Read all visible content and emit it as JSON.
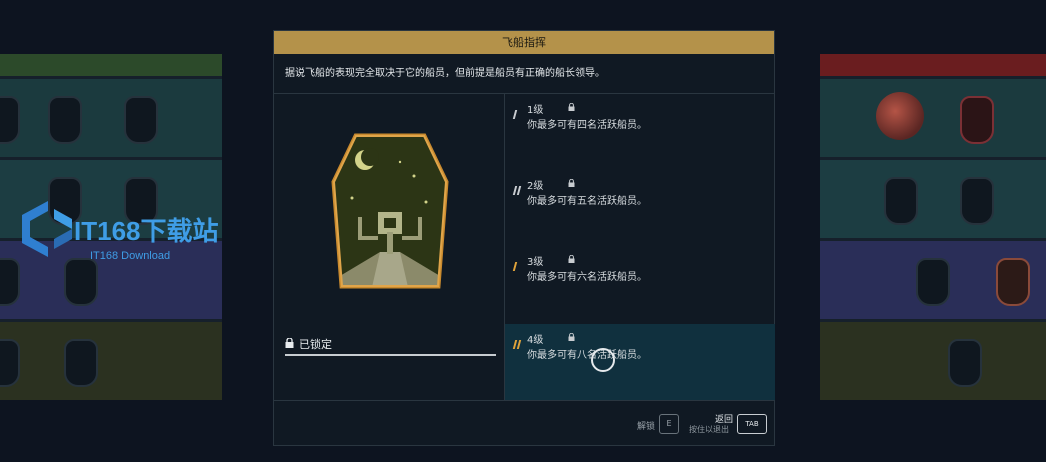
{
  "dialog": {
    "title": "飞船指挥",
    "description": "据说飞船的表现完全取决于它的船员，但前提是船员有正确的船长领导。",
    "lock_status": "已锁定",
    "tiers": [
      {
        "level": "1级",
        "desc": "你最多可有四名活跃船员。",
        "mark_count": 1,
        "mark_color": "#c8ccd0"
      },
      {
        "level": "2级",
        "desc": "你最多可有五名活跃船员。",
        "mark_count": 2,
        "mark_color": "#c8ccd0"
      },
      {
        "level": "3级",
        "desc": "你最多可有六名活跃船员。",
        "mark_count": 1,
        "mark_color": "#e0a33a"
      },
      {
        "level": "4级",
        "desc": "你最多可有八名活跃船员。",
        "mark_count": 2,
        "mark_color": "#e0a33a"
      }
    ],
    "active_tier": 4
  },
  "footer": {
    "unlock_label": "解锁",
    "unlock_key": "E",
    "back_label": "返回",
    "back_hint": "按住以退出",
    "back_key": "TAB"
  },
  "watermark": {
    "title": "IT168下载站",
    "subtitle": "IT168 Download"
  },
  "colors": {
    "accent_gold": "#b4924a",
    "active_row": "#10303e",
    "tier_orange": "#e0a33a"
  }
}
